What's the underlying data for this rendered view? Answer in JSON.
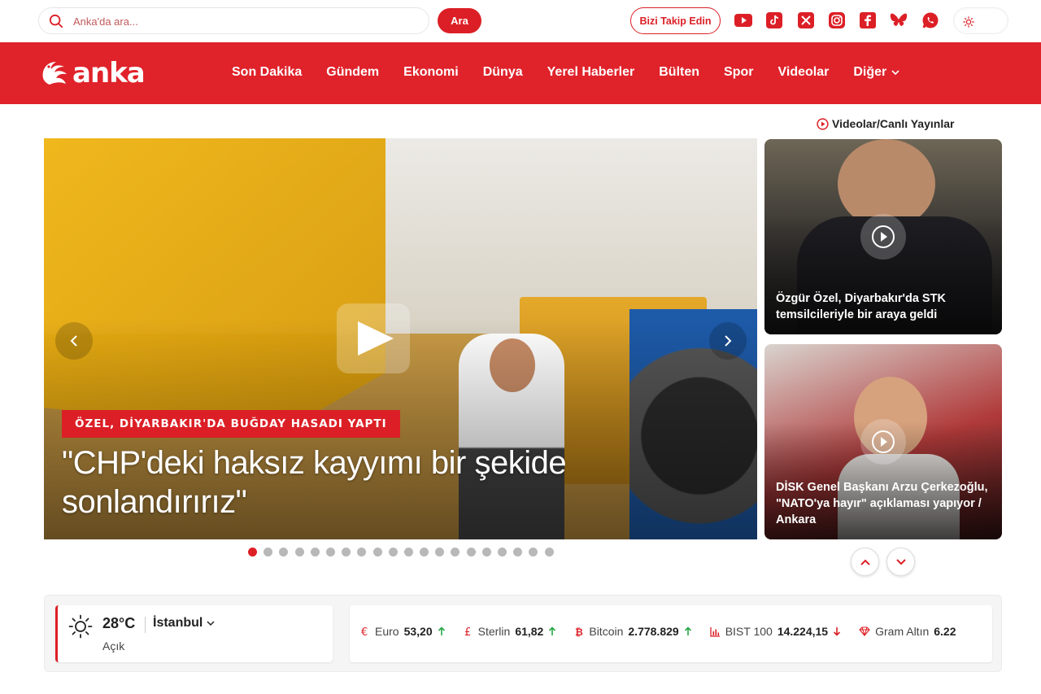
{
  "search": {
    "placeholder": "Anka'da ara...",
    "button": "Ara"
  },
  "header": {
    "follow_label": "Bizi Takip Edin"
  },
  "brand": {
    "logo_text": "anka",
    "accent": "#e0222a"
  },
  "nav": {
    "items": [
      "Son Dakika",
      "Gündem",
      "Ekonomi",
      "Dünya",
      "Yerel Haberler",
      "Bülten",
      "Spor",
      "Videolar",
      "Diğer"
    ]
  },
  "videos": {
    "header": "Videolar/Canlı Yayınlar",
    "cards": [
      {
        "caption": "Özgür Özel, Diyarbakır'da STK temsilcileriyle bir araya geldi"
      },
      {
        "caption": "DİSK Genel Başkanı Arzu Çerkezoğlu, \"NATO'ya hayır\" açıklaması yapıyor / Ankara"
      }
    ]
  },
  "hero": {
    "tag": "ÖZEL, DİYARBAKIR'DA BUĞDAY HASADI YAPTI",
    "title": "\"CHP'deki haksız kayyımı bir şekide sonlandırırız\"",
    "slide_count": 20,
    "active_slide": 1
  },
  "weather": {
    "temp": "28°C",
    "city": "İstanbul",
    "condition": "Açık"
  },
  "market": [
    {
      "label": "Euro",
      "value": "53,20",
      "trend": "up",
      "icon": "euro-icon"
    },
    {
      "label": "Sterlin",
      "value": "61,82",
      "trend": "up",
      "icon": "pound-icon"
    },
    {
      "label": "Bitcoin",
      "value": "2.778.829",
      "trend": "up",
      "icon": "bitcoin-icon"
    },
    {
      "label": "BIST 100",
      "value": "14.224,15",
      "trend": "down",
      "icon": "chart-icon"
    },
    {
      "label": "Gram Altın",
      "value": "6.22",
      "trend": "",
      "icon": "gem-icon"
    }
  ]
}
